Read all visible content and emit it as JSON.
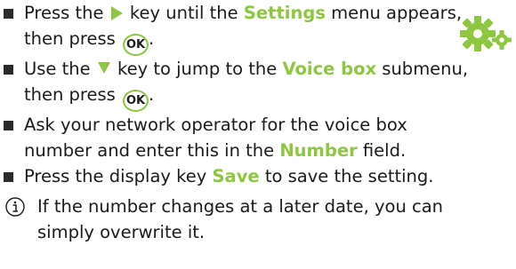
{
  "steps": [
    {
      "part1": "Press the ",
      "icon": "right-arrow-key-icon",
      "part2": " key until the ",
      "highlight": "Settings",
      "part3": " menu appears, then press ",
      "key": "OK",
      "part4": "."
    },
    {
      "part1": "Use the ",
      "icon": "down-arrow-key-icon",
      "part2": " key to jump to the ",
      "highlight": "Voice box",
      "part3": " submenu, then press ",
      "key": "OK",
      "part4": "."
    },
    {
      "part1": "Ask your network operator for the voice box number and enter this in the ",
      "highlight": "Number",
      "part2": " field."
    },
    {
      "part1": "Press the display key ",
      "highlight": "Save",
      "part2": " to save the setting."
    }
  ],
  "note": {
    "icon": "info-icon",
    "text": "If the number changes at a later date, you can simply overwrite it."
  },
  "settings_icon": "settings-gears-icon",
  "colors": {
    "accent": "#8dc63f",
    "text": "#1a1a1a"
  }
}
